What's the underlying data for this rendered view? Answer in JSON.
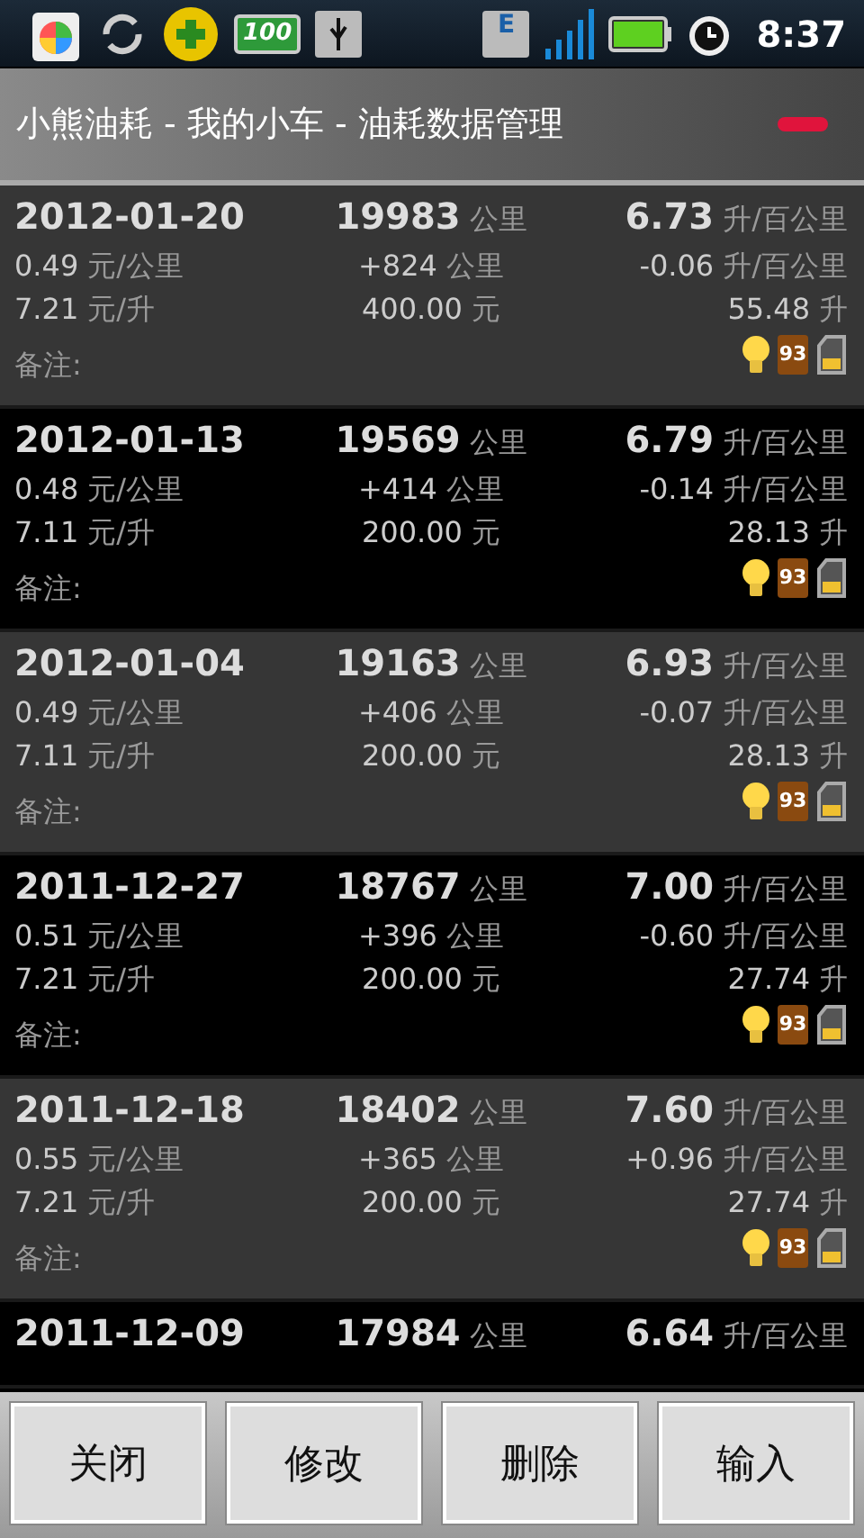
{
  "status_bar": {
    "battery_badge": "100",
    "network": "E",
    "time": "8:37"
  },
  "title": "小熊油耗 - 我的小车 - 油耗数据管理",
  "records": [
    {
      "date": "2012-01-20",
      "odometer": "19983",
      "odometer_unit": "公里",
      "consumption": "6.73",
      "consumption_unit": "升/百公里",
      "cost_per_km": "0.49",
      "cost_per_km_unit": "元/公里",
      "distance": "+824",
      "distance_unit": "公里",
      "change": "-0.06",
      "change_unit": "升/百公里",
      "price": "7.21",
      "price_unit": "元/升",
      "amount": "400.00",
      "amount_unit": "元",
      "volume": "55.48",
      "volume_unit": "升",
      "note_label": "备注:",
      "grade": "93"
    },
    {
      "date": "2012-01-13",
      "odometer": "19569",
      "odometer_unit": "公里",
      "consumption": "6.79",
      "consumption_unit": "升/百公里",
      "cost_per_km": "0.48",
      "cost_per_km_unit": "元/公里",
      "distance": "+414",
      "distance_unit": "公里",
      "change": "-0.14",
      "change_unit": "升/百公里",
      "price": "7.11",
      "price_unit": "元/升",
      "amount": "200.00",
      "amount_unit": "元",
      "volume": "28.13",
      "volume_unit": "升",
      "note_label": "备注:",
      "grade": "93"
    },
    {
      "date": "2012-01-04",
      "odometer": "19163",
      "odometer_unit": "公里",
      "consumption": "6.93",
      "consumption_unit": "升/百公里",
      "cost_per_km": "0.49",
      "cost_per_km_unit": "元/公里",
      "distance": "+406",
      "distance_unit": "公里",
      "change": "-0.07",
      "change_unit": "升/百公里",
      "price": "7.11",
      "price_unit": "元/升",
      "amount": "200.00",
      "amount_unit": "元",
      "volume": "28.13",
      "volume_unit": "升",
      "note_label": "备注:",
      "grade": "93"
    },
    {
      "date": "2011-12-27",
      "odometer": "18767",
      "odometer_unit": "公里",
      "consumption": "7.00",
      "consumption_unit": "升/百公里",
      "cost_per_km": "0.51",
      "cost_per_km_unit": "元/公里",
      "distance": "+396",
      "distance_unit": "公里",
      "change": "-0.60",
      "change_unit": "升/百公里",
      "price": "7.21",
      "price_unit": "元/升",
      "amount": "200.00",
      "amount_unit": "元",
      "volume": "27.74",
      "volume_unit": "升",
      "note_label": "备注:",
      "grade": "93"
    },
    {
      "date": "2011-12-18",
      "odometer": "18402",
      "odometer_unit": "公里",
      "consumption": "7.60",
      "consumption_unit": "升/百公里",
      "cost_per_km": "0.55",
      "cost_per_km_unit": "元/公里",
      "distance": "+365",
      "distance_unit": "公里",
      "change": "+0.96",
      "change_unit": "升/百公里",
      "price": "7.21",
      "price_unit": "元/升",
      "amount": "200.00",
      "amount_unit": "元",
      "volume": "27.74",
      "volume_unit": "升",
      "note_label": "备注:",
      "grade": "93"
    },
    {
      "date": "2011-12-09",
      "odometer": "17984",
      "odometer_unit": "公里",
      "consumption": "6.64",
      "consumption_unit": "升/百公里"
    }
  ],
  "buttons": [
    "关闭",
    "修改",
    "删除",
    "输入"
  ]
}
